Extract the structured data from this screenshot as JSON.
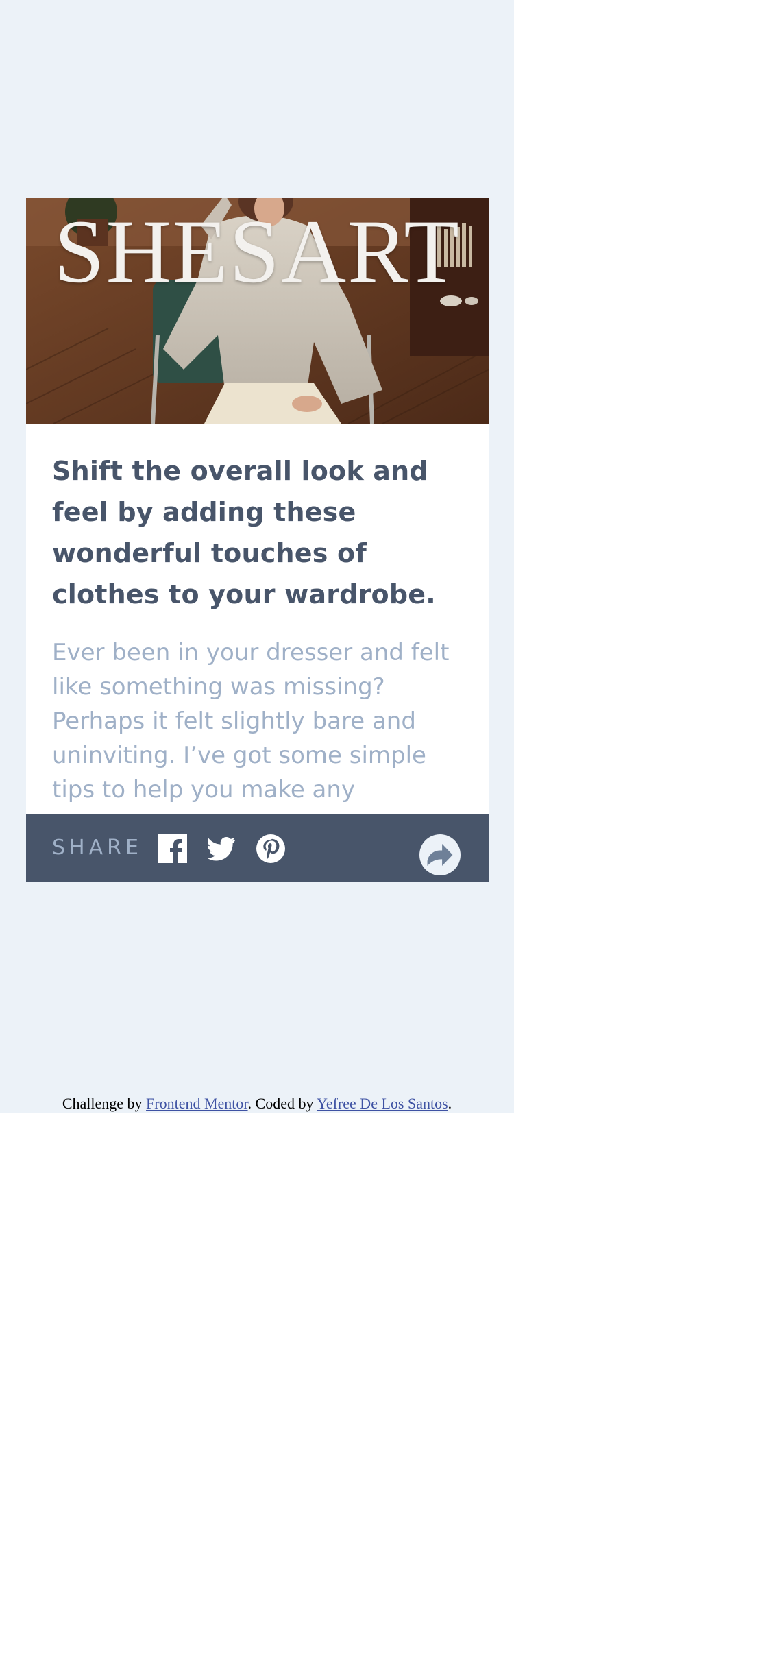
{
  "hero": {
    "brand_text": "SHESART"
  },
  "article": {
    "headline": "Shift the overall look and feel by adding these wonderful touches of clothes to your wardrobe.",
    "excerpt": "Ever been in your dresser and felt like something was missing? Perhaps it felt slightly bare and uninviting. I’ve got some simple tips to help you make any wardrobe feel complete."
  },
  "share_bar": {
    "label": "SHARE",
    "icons": [
      "facebook-icon",
      "twitter-icon",
      "pinterest-icon"
    ],
    "share_button_icon": "share-arrow-icon"
  },
  "attribution": {
    "prefix": "Challenge by ",
    "link1": "Frontend Mentor",
    "middle": ". Coded by ",
    "link2": "Yefree De Los Santos",
    "suffix": "."
  },
  "colors": {
    "page_background": "#ecf2f8",
    "card_background": "#ffffff",
    "headline": "#48556a",
    "excerpt": "#9fb0c7",
    "share_bar": "#48556a",
    "link": "#3e52a3"
  }
}
